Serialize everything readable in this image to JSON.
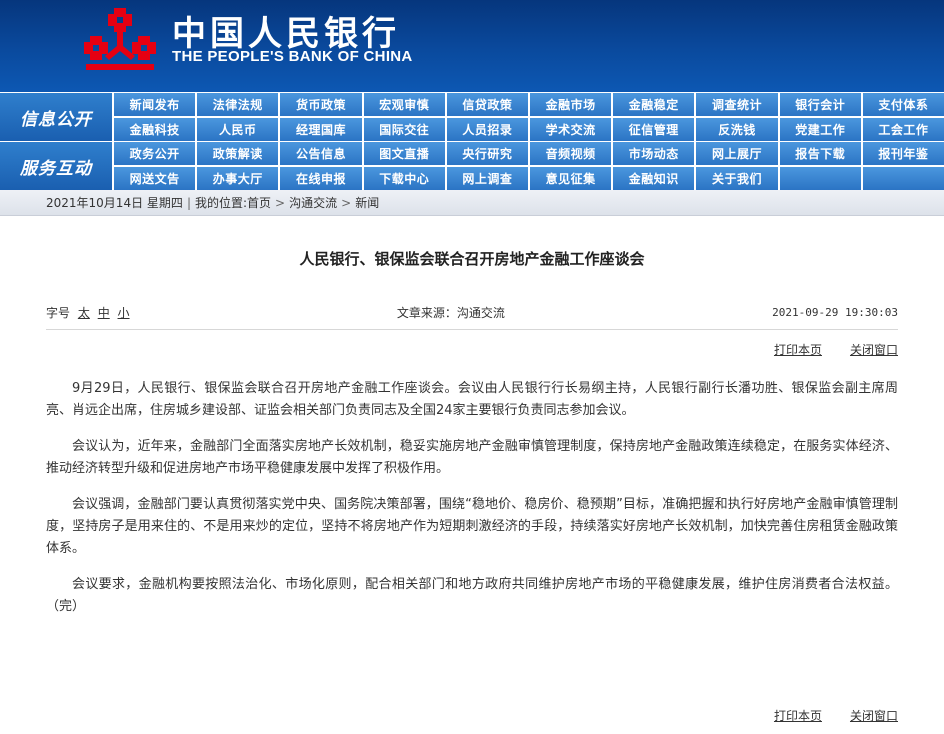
{
  "brand": {
    "name_cn": "中国人民银行",
    "name_en": "THE PEOPLE'S BANK OF CHINA",
    "logo_color": "#e60012"
  },
  "nav": {
    "section1_label": "信息公开",
    "section2_label": "服务互动",
    "section1_items": [
      "新闻发布",
      "法律法规",
      "货币政策",
      "宏观审慎",
      "信贷政策",
      "金融市场",
      "金融稳定",
      "调查统计",
      "银行会计",
      "支付体系",
      "金融科技",
      "人民币",
      "经理国库",
      "国际交往",
      "人员招录",
      "学术交流",
      "征信管理",
      "反洗钱",
      "党建工作",
      "工会工作"
    ],
    "section2_items": [
      "政务公开",
      "政策解读",
      "公告信息",
      "图文直播",
      "央行研究",
      "音频视频",
      "市场动态",
      "网上展厅",
      "报告下载",
      "报刊年鉴",
      "网送文告",
      "办事大厅",
      "在线申报",
      "下载中心",
      "网上调查",
      "意见征集",
      "金融知识",
      "关于我们",
      "",
      ""
    ]
  },
  "breadcrumb": {
    "date": "2021年10月14日",
    "weekday": "星期四",
    "location_label": "我的位置:",
    "home": "首页",
    "level1": "沟通交流",
    "level2": "新闻"
  },
  "article": {
    "title": "人民银行、银保监会联合召开房地产金融工作座谈会",
    "font_label": "字号",
    "font_large": "太",
    "font_medium": "中",
    "font_small": "小",
    "source": "文章来源：沟通交流",
    "datetime": "2021-09-29  19:30:03",
    "print_label": "打印本页",
    "close_label": "关闭窗口",
    "paragraphs": [
      "9月29日，人民银行、银保监会联合召开房地产金融工作座谈会。会议由人民银行行长易纲主持，人民银行副行长潘功胜、银保监会副主席周亮、肖远企出席，住房城乡建设部、证监会相关部门负责同志及全国24家主要银行负责同志参加会议。",
      "会议认为，近年来，金融部门全面落实房地产长效机制，稳妥实施房地产金融审慎管理制度，保持房地产金融政策连续稳定，在服务实体经济、推动经济转型升级和促进房地产市场平稳健康发展中发挥了积极作用。",
      "会议强调，金融部门要认真贯彻落实党中央、国务院决策部署，围绕“稳地价、稳房价、稳预期”目标，准确把握和执行好房地产金融审慎管理制度，坚持房子是用来住的、不是用来炒的定位，坚持不将房地产作为短期刺激经济的手段，持续落实好房地产长效机制，加快完善住房租赁金融政策体系。",
      "会议要求，金融机构要按照法治化、市场化原则，配合相关部门和地方政府共同维护房地产市场的平稳健康发展，维护住房消费者合法权益。（完）"
    ]
  }
}
